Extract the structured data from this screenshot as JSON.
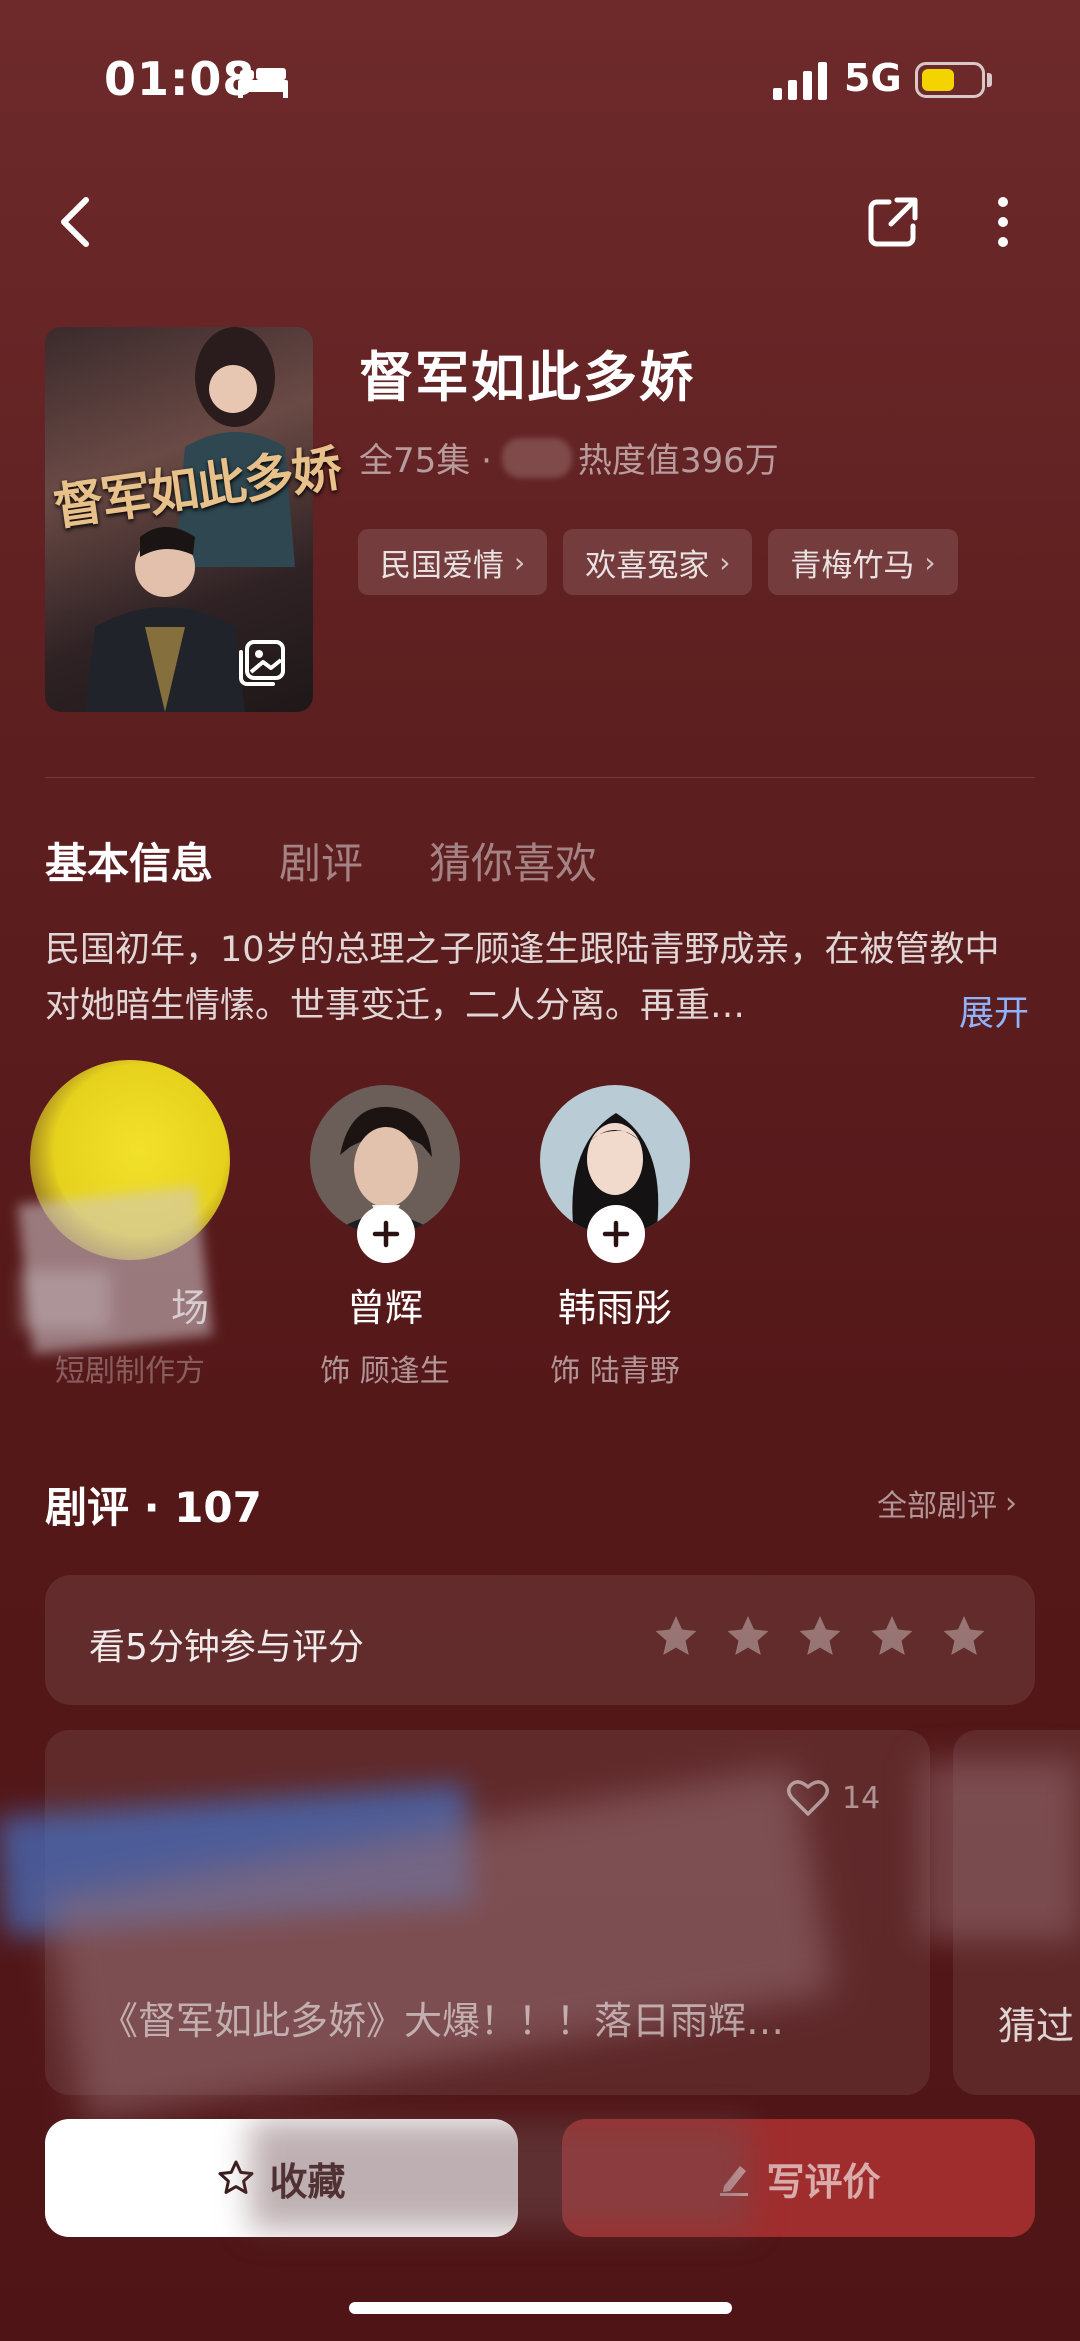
{
  "status_bar": {
    "time": "01:08",
    "network": "5G",
    "battery_level": 0.55
  },
  "nav": {
    "back_icon": "back-arrow-icon",
    "share_icon": "share-icon",
    "more_icon": "more-vertical-icon"
  },
  "show": {
    "title": "督军如此多娇",
    "poster_title": "督军如此多娇",
    "episodes": "全75集 ·",
    "heat": "热度值396万",
    "tags": [
      {
        "label": "民国爱情"
      },
      {
        "label": "欢喜冤家"
      },
      {
        "label": "青梅竹马"
      }
    ]
  },
  "tabs": [
    {
      "label": "基本信息",
      "active": true
    },
    {
      "label": "剧评",
      "active": false
    },
    {
      "label": "猜你喜欢",
      "active": false
    }
  ],
  "synopsis": {
    "text": "民国初年，10岁的总理之子顾逢生跟陆青野成亲，在被管教中对她暗生情愫。世事变迁，二人分离。再重…",
    "expand_label": "展开"
  },
  "cast": [
    {
      "name": "场",
      "role": "短剧制作方"
    },
    {
      "name": "曾辉",
      "role": "饰 顾逢生"
    },
    {
      "name": "韩雨彤",
      "role": "饰 陆青野"
    }
  ],
  "reviews": {
    "title": "剧评 · 107",
    "all_label": "全部剧评",
    "rate_prompt": "看5分钟参与评分",
    "stars": 5,
    "card": {
      "likes": "14",
      "snippet": "《督军如此多娇》大爆！！！落日雨辉…"
    },
    "card2": {
      "snippet": "猜过"
    }
  },
  "actions": {
    "collect_label": "收藏",
    "review_label": "写评价"
  },
  "colors": {
    "background": "#5a1a1b",
    "accent_link": "#8fb4ff",
    "review_button": "#a02d2d",
    "battery": "#f4d400"
  }
}
